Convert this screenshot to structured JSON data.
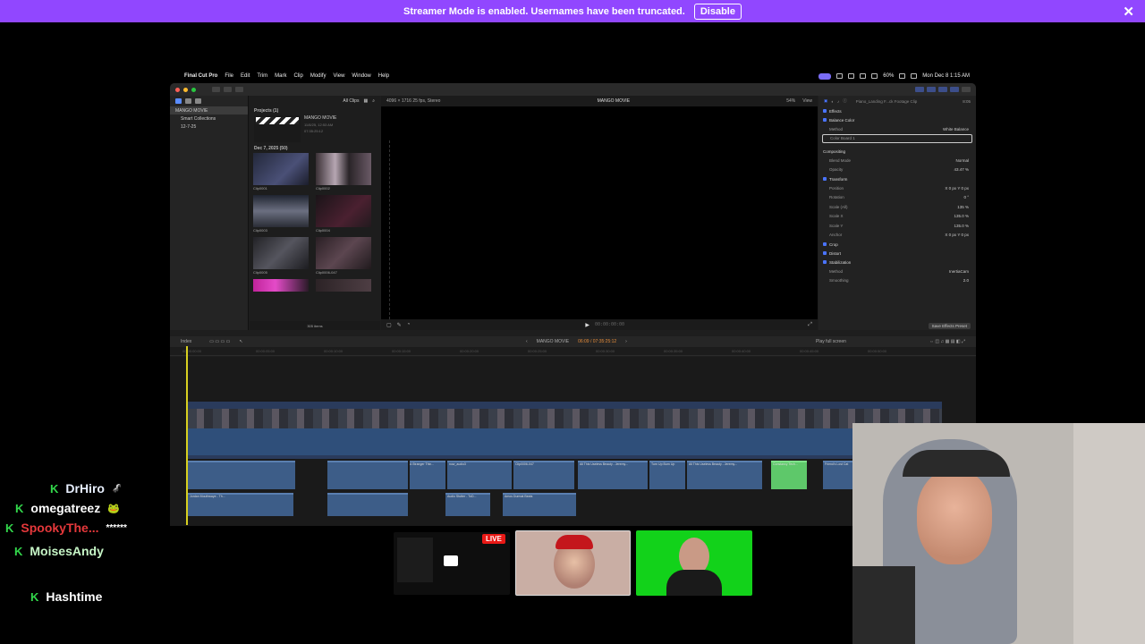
{
  "banner": {
    "text": "Streamer Mode is enabled. Usernames have been truncated.",
    "button": "Disable",
    "close": "✕",
    "color": "#9147ff"
  },
  "menubar": {
    "apple": "",
    "app": "Final Cut Pro",
    "items": [
      "File",
      "Edit",
      "Trim",
      "Mark",
      "Clip",
      "Modify",
      "View",
      "Window",
      "Help"
    ],
    "battery": "60%",
    "clock": "Mon Dec 8  1:15 AM"
  },
  "library": {
    "items": [
      "MANGO MOVIE",
      "Smart Collections",
      "12-7-25"
    ]
  },
  "browser": {
    "filter": "All Clips",
    "projects_header": "Projects  (1)",
    "project_name": "MANGO MOVIE",
    "project_date": "11/8/25, 12:53 AM",
    "project_duration": "07:35:25:12",
    "event_header": "Dec 7, 2025  (50)",
    "clips": [
      "Clip0001",
      "Clip0002",
      "Clip0003",
      "Clip0004",
      "Clip0005",
      "Clip0006-047",
      "",
      ""
    ],
    "items_count": "305 items"
  },
  "viewer": {
    "format": "4096 × 1716  25 fps, Stereo",
    "title": "MANGO MOVIE",
    "zoom": "54%",
    "view": "View",
    "timecode": "00:00:00:00"
  },
  "inspector": {
    "title": "Piano_Landing F...ck Footage Clip",
    "duration": "8:05",
    "sections": [
      {
        "name": "Effects",
        "rows": []
      },
      {
        "name": "Balance Color",
        "rows": [
          {
            "label": "Method",
            "value": "White Balance"
          },
          {
            "label": "Color Board 1",
            "value": ""
          }
        ]
      },
      {
        "name": "Compositing",
        "rows": [
          {
            "label": "Blend Mode",
            "value": "Normal"
          },
          {
            "label": "Opacity",
            "value": "43.47 %"
          }
        ]
      },
      {
        "name": "Transform",
        "rows": [
          {
            "label": "Position",
            "value": "X 0 px  Y 0 px"
          },
          {
            "label": "Rotation",
            "value": "0 °"
          },
          {
            "label": "Scale (All)",
            "value": "135 %"
          },
          {
            "label": "Scale X",
            "value": "135.0 %"
          },
          {
            "label": "Scale Y",
            "value": "135.0 %"
          },
          {
            "label": "Anchor",
            "value": "X 0 px  Y 0 px"
          }
        ]
      },
      {
        "name": "Crop",
        "rows": []
      },
      {
        "name": "Distort",
        "rows": []
      },
      {
        "name": "Stabilization",
        "rows": [
          {
            "label": "Method",
            "value": "InertiaCam"
          },
          {
            "label": "Smoothing",
            "value": "2.0"
          }
        ]
      },
      {
        "name": "Rolling Shutter",
        "rows": []
      }
    ],
    "save_preset": "Save Effects Preset"
  },
  "timeline": {
    "index": "Index",
    "project": "MANGO MOVIE",
    "duration": "06:09 / 07:35:25:12",
    "play_full": "Play full screen",
    "ruler": [
      "00:00:00:00",
      "00:00:05:00",
      "00:00:10:00",
      "00:00:15:00",
      "00:00:20:00",
      "00:00:25:00",
      "00:00:30:00",
      "00:00:35:00",
      "00:00:40:00",
      "00:00:45:00",
      "00:00:50:00"
    ],
    "connected_labels": [
      "A Stranger Thin...",
      "now_audio3",
      "Clip0006-047",
      "All This Useless Beauty - Jeremy...",
      "Turn Up Burn Up",
      "All This Useless Beauty - Jeremy...",
      "Constancy Tech...",
      "Friend's Lost Cat",
      "Audio Stutter - ToD...",
      "Amos Durmat Beats",
      "Jordan Mouthwaye - Th..."
    ]
  },
  "chat": [
    {
      "badge": "K",
      "name": "DrHiro",
      "emote": "🦨",
      "color": "#e8f0ff"
    },
    {
      "badge": "K",
      "name": "omegatreez",
      "emote": "🐸",
      "color": "#ffffff"
    },
    {
      "badge": "K",
      "name": "SpookyThe...",
      "emote": "******",
      "color": "#e5383b"
    },
    {
      "badge": "K",
      "name": "MoisesAndy",
      "emote": "",
      "color": "#c6f5c6"
    },
    {
      "badge": "K",
      "name": "Hashtime",
      "emote": "",
      "color": "#ffffff"
    }
  ],
  "live_badge": "LIVE"
}
